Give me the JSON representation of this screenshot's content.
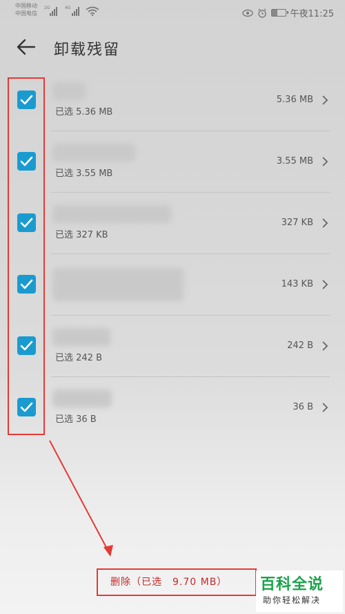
{
  "status_bar": {
    "carrier_1": "中国移动",
    "carrier_2": "中国电信",
    "net_1": "2G",
    "net_2": "4G",
    "time": "午夜11:25"
  },
  "header": {
    "title": "卸载残留"
  },
  "items": [
    {
      "selected": "已选 5.36 MB",
      "size": "5.36 MB",
      "checked": true
    },
    {
      "selected": "已选 3.55 MB",
      "size": "3.55 MB",
      "checked": true
    },
    {
      "selected": "已选 327 KB",
      "size": "327 KB",
      "checked": true
    },
    {
      "selected": "",
      "size": "143 KB",
      "checked": true
    },
    {
      "selected": "已选 242 B",
      "size": "242 B",
      "checked": true
    },
    {
      "selected": "已选 36 B",
      "size": "36 B",
      "checked": true
    }
  ],
  "footer": {
    "delete_label": "删除（已选　9.70 MB）"
  },
  "watermark": {
    "title": "百科全说",
    "subtitle": "助你轻松解决"
  },
  "colors": {
    "checkbox": "#1a9bd0",
    "annotation": "#e53935",
    "watermark_green": "#1aa34a"
  }
}
